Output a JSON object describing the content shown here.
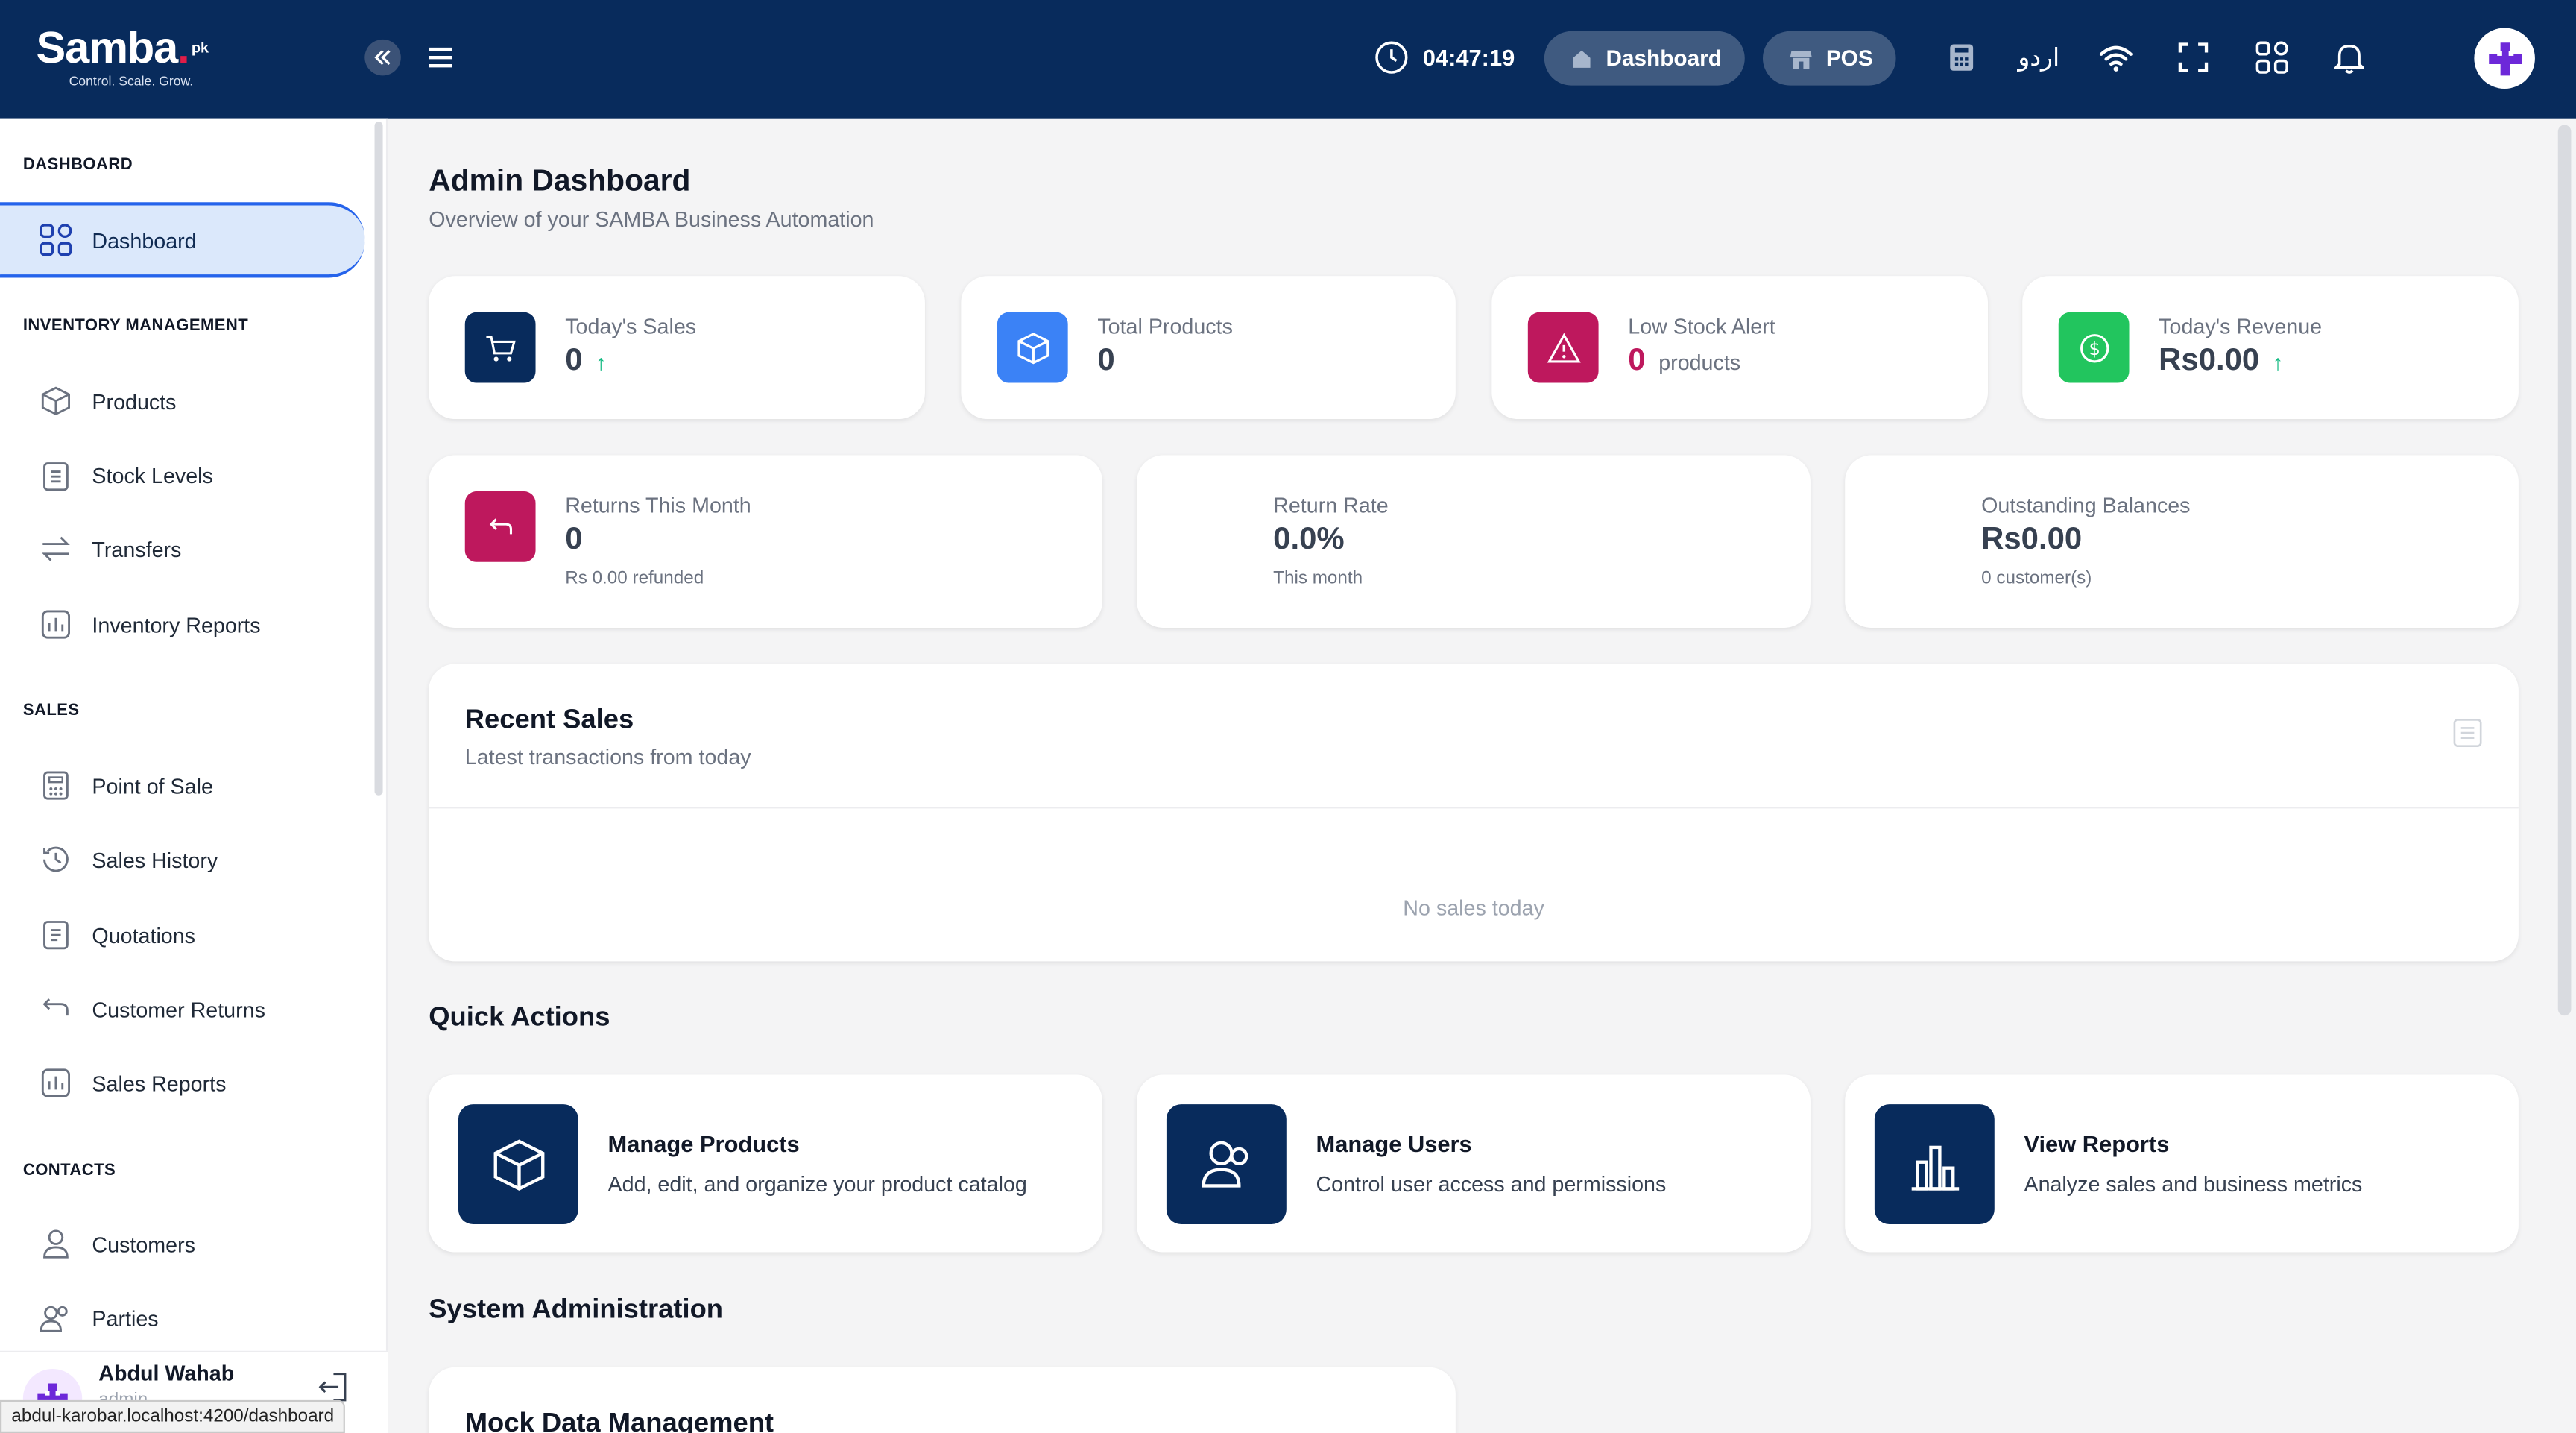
{
  "app": {
    "brand": "Samba",
    "brand_suffix": "pk",
    "tagline": "Control. Scale. Grow."
  },
  "topbar": {
    "time": "04:47:19",
    "dashboard_label": "Dashboard",
    "pos_label": "POS",
    "language_label": "اردو",
    "icons": [
      "calculator-icon",
      "wifi-icon",
      "fullscreen-icon",
      "apps-grid-icon",
      "bell-icon"
    ]
  },
  "sidebar": {
    "sections": {
      "dashboard": "DASHBOARD",
      "inventory": "INVENTORY MANAGEMENT",
      "sales": "SALES",
      "contacts": "CONTACTS"
    },
    "items": {
      "dashboard": "Dashboard",
      "products": "Products",
      "stock_levels": "Stock Levels",
      "transfers": "Transfers",
      "inventory_reports": "Inventory Reports",
      "point_of_sale": "Point of Sale",
      "sales_history": "Sales History",
      "quotations": "Quotations",
      "customer_returns": "Customer Returns",
      "sales_reports": "Sales Reports",
      "customers": "Customers",
      "parties": "Parties"
    },
    "user": {
      "name": "Abdul Wahab",
      "role": "admin"
    }
  },
  "status_url": "abdul-karobar.localhost:4200/dashboard",
  "main": {
    "title": "Admin Dashboard",
    "subtitle": "Overview of your SAMBA Business Automation",
    "stats": {
      "todays_sales": {
        "label": "Today's Sales",
        "value": "0"
      },
      "total_products": {
        "label": "Total Products",
        "value": "0"
      },
      "low_stock": {
        "label": "Low Stock Alert",
        "value": "0",
        "unit": "products"
      },
      "todays_revenue": {
        "label": "Today's Revenue",
        "value": "Rs0.00"
      },
      "returns_month": {
        "label": "Returns This Month",
        "value": "0",
        "sub": "Rs 0.00 refunded"
      },
      "return_rate": {
        "label": "Return Rate",
        "value": "0.0%",
        "sub": "This month"
      },
      "outstanding": {
        "label": "Outstanding Balances",
        "value": "Rs0.00",
        "sub": "0 customer(s)"
      }
    },
    "recent_sales": {
      "title": "Recent Sales",
      "subtitle": "Latest transactions from today",
      "empty": "No sales today"
    },
    "quick_actions": {
      "title": "Quick Actions",
      "items": {
        "products": {
          "title": "Manage Products",
          "desc": "Add, edit, and organize your product catalog"
        },
        "users": {
          "title": "Manage Users",
          "desc": "Control user access and permissions"
        },
        "reports": {
          "title": "View Reports",
          "desc": "Analyze sales and business metrics"
        }
      }
    },
    "system_admin": {
      "title": "System Administration",
      "mock_title": "Mock Data Management"
    }
  },
  "colors": {
    "topbar": "#082b5c",
    "sales_icon": "#082b5c",
    "products_icon": "#3b82f6",
    "low_stock_icon": "#be185d",
    "revenue_icon": "#22c55e",
    "returns_icon": "#be185d",
    "active_nav": "#dbe8fb"
  }
}
